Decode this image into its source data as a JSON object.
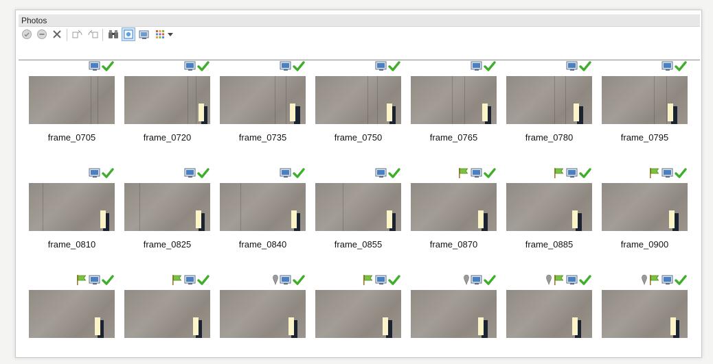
{
  "panel": {
    "title": "Photos"
  },
  "toolbar": {
    "icons": [
      "enable-icon",
      "disable-icon",
      "remove-icon",
      "rotate-left-icon",
      "rotate-right-icon",
      "binoculars-icon",
      "mask-icon",
      "image-view-icon",
      "grid-view-icon",
      "dropdown-arrow-icon"
    ]
  },
  "photos": [
    {
      "label": "frame_0705",
      "badges": [
        "camera",
        "check"
      ]
    },
    {
      "label": "frame_0720",
      "badges": [
        "camera",
        "check"
      ]
    },
    {
      "label": "frame_0735",
      "badges": [
        "camera",
        "check"
      ]
    },
    {
      "label": "frame_0750",
      "badges": [
        "camera",
        "check"
      ]
    },
    {
      "label": "frame_0765",
      "badges": [
        "camera",
        "check"
      ]
    },
    {
      "label": "frame_0780",
      "badges": [
        "camera",
        "check"
      ]
    },
    {
      "label": "frame_0795",
      "badges": [
        "camera",
        "check"
      ]
    },
    {
      "label": "frame_0810",
      "badges": [
        "camera",
        "check"
      ]
    },
    {
      "label": "frame_0825",
      "badges": [
        "camera",
        "check"
      ]
    },
    {
      "label": "frame_0840",
      "badges": [
        "camera",
        "check"
      ]
    },
    {
      "label": "frame_0855",
      "badges": [
        "camera",
        "check"
      ]
    },
    {
      "label": "frame_0870",
      "badges": [
        "flag",
        "camera",
        "check"
      ]
    },
    {
      "label": "frame_0885",
      "badges": [
        "flag",
        "camera",
        "check"
      ]
    },
    {
      "label": "frame_0900",
      "badges": [
        "flag",
        "camera",
        "check"
      ]
    },
    {
      "label": "",
      "badges": [
        "flag",
        "camera",
        "check"
      ]
    },
    {
      "label": "",
      "badges": [
        "flag",
        "camera",
        "check"
      ]
    },
    {
      "label": "",
      "badges": [
        "pin",
        "camera",
        "check"
      ]
    },
    {
      "label": "",
      "badges": [
        "flag",
        "camera",
        "check"
      ]
    },
    {
      "label": "",
      "badges": [
        "pin",
        "camera",
        "check"
      ]
    },
    {
      "label": "",
      "badges": [
        "pin",
        "flag",
        "camera",
        "check"
      ]
    },
    {
      "label": "",
      "badges": [
        "pin",
        "flag",
        "camera",
        "check"
      ]
    }
  ],
  "colors": {
    "check": "#3fae2a",
    "flag": "#7bc142",
    "camera": "#4a7fc1",
    "pin": "#9a9a9a"
  }
}
